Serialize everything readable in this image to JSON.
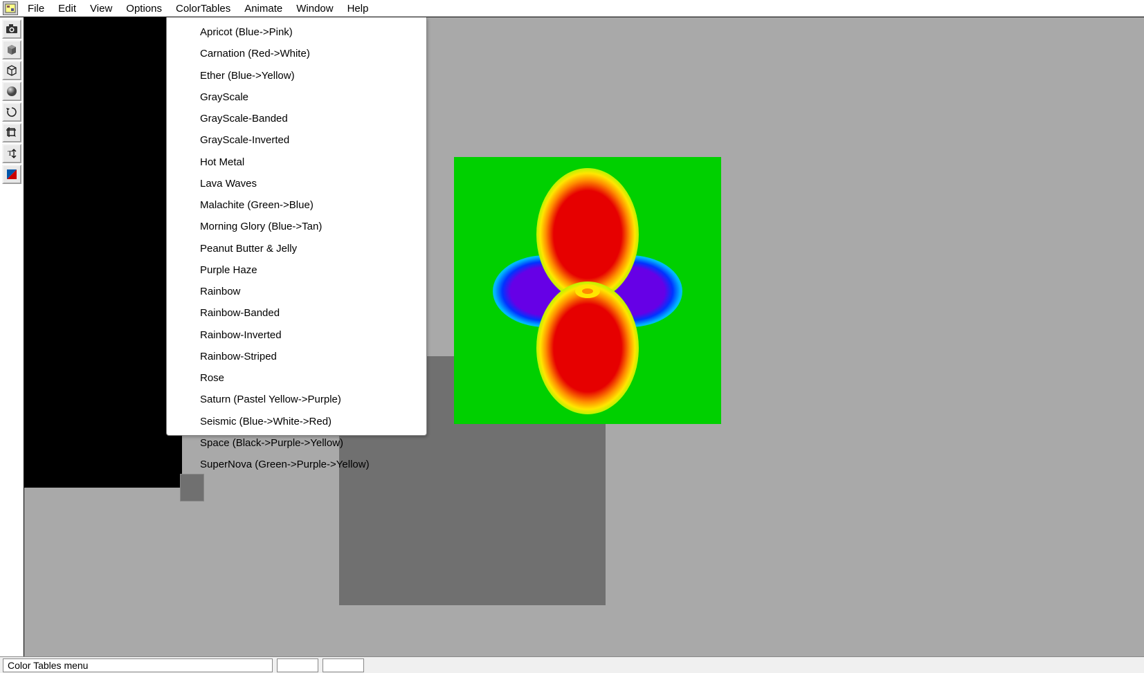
{
  "menubar": {
    "items": [
      "File",
      "Edit",
      "View",
      "Options",
      "ColorTables",
      "Animate",
      "Window",
      "Help"
    ]
  },
  "toolbar": {
    "buttons": [
      {
        "name": "camera-icon"
      },
      {
        "name": "cube-solid-icon"
      },
      {
        "name": "cube-wire-icon"
      },
      {
        "name": "sphere-icon"
      },
      {
        "name": "rotate-icon"
      },
      {
        "name": "crop-icon"
      },
      {
        "name": "text-arrows-icon"
      },
      {
        "name": "gradient-icon"
      }
    ]
  },
  "dropdown": {
    "items": [
      "Apricot (Blue->Pink)",
      "Carnation (Red->White)",
      "Ether (Blue->Yellow)",
      "GrayScale",
      "GrayScale-Banded",
      "GrayScale-Inverted",
      "Hot Metal",
      "Lava Waves",
      "Malachite (Green->Blue)",
      "Morning Glory (Blue->Tan)",
      "Peanut Butter & Jelly",
      "Purple Haze",
      "Rainbow",
      "Rainbow-Banded",
      "Rainbow-Inverted",
      "Rainbow-Striped",
      "Rose",
      "Saturn (Pastel Yellow->Purple)",
      "Seismic (Blue->White->Red)",
      "Space (Black->Purple->Yellow)",
      "SuperNova (Green->Purple->Yellow)"
    ]
  },
  "statusbar": {
    "text": "Color Tables menu",
    "field1": "",
    "field2": ""
  }
}
